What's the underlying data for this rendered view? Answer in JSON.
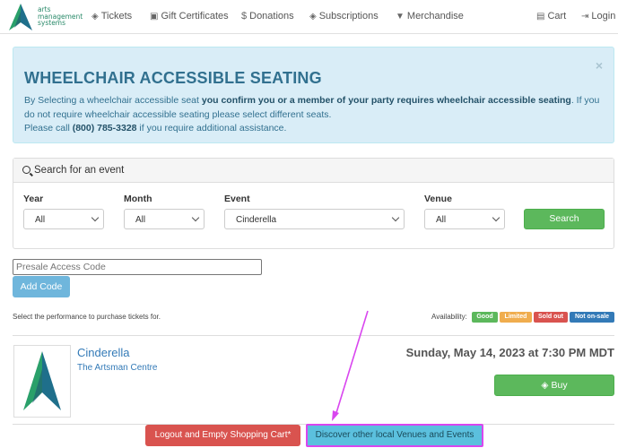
{
  "logo": {
    "line1": "arts",
    "line2": "management",
    "line3": "systems"
  },
  "nav": {
    "tickets": "Tickets",
    "gift_certificates": "Gift Certificates",
    "donations": "Donations",
    "subscriptions": "Subscriptions",
    "merchandise": "Merchandise",
    "cart": "Cart",
    "login": "Login"
  },
  "alert": {
    "title": "WHEELCHAIR ACCESSIBLE SEATING",
    "p1_a": "By Selecting a wheelchair accessible seat ",
    "p1_bold": "you confirm you or a member of your party requires wheelchair accessible seating",
    "p1_b": ". If you do not require wheelchair accessible seating please select different seats.",
    "p2_a": "Please call ",
    "p2_bold": "(800) 785-3328",
    "p2_b": " if you require additional assistance.",
    "close": "×"
  },
  "search": {
    "title": "Search for an event",
    "year_label": "Year",
    "year_value": "All",
    "month_label": "Month",
    "month_value": "All",
    "event_label": "Event",
    "event_value": "Cinderella",
    "venue_label": "Venue",
    "venue_value": "All",
    "button": "Search"
  },
  "presale": {
    "placeholder": "Presale Access Code",
    "button": "Add Code"
  },
  "info": {
    "select_text": "Select the performance to purchase tickets for.",
    "availability_label": "Availability:",
    "badges": [
      {
        "label": "Good",
        "color": "#5cb85c"
      },
      {
        "label": "Limited",
        "color": "#f0ad4e"
      },
      {
        "label": "Sold out",
        "color": "#d9534f"
      },
      {
        "label": "Not on-sale",
        "color": "#337ab7"
      }
    ]
  },
  "event": {
    "name": "Cinderella",
    "venue": "The Artsman Centre",
    "date": "Sunday, May 14, 2023 at 7:30 PM MDT",
    "buy_button": "Buy"
  },
  "footer": {
    "logout": "Logout and Empty Shopping Cart*",
    "discover": "Discover other local Venues and Events"
  },
  "colors": {
    "alert_bg": "#d9edf7",
    "alert_text": "#31708f",
    "success": "#5cb85c",
    "danger": "#d9534f",
    "info": "#5bc0de",
    "highlight": "#d946ef"
  }
}
